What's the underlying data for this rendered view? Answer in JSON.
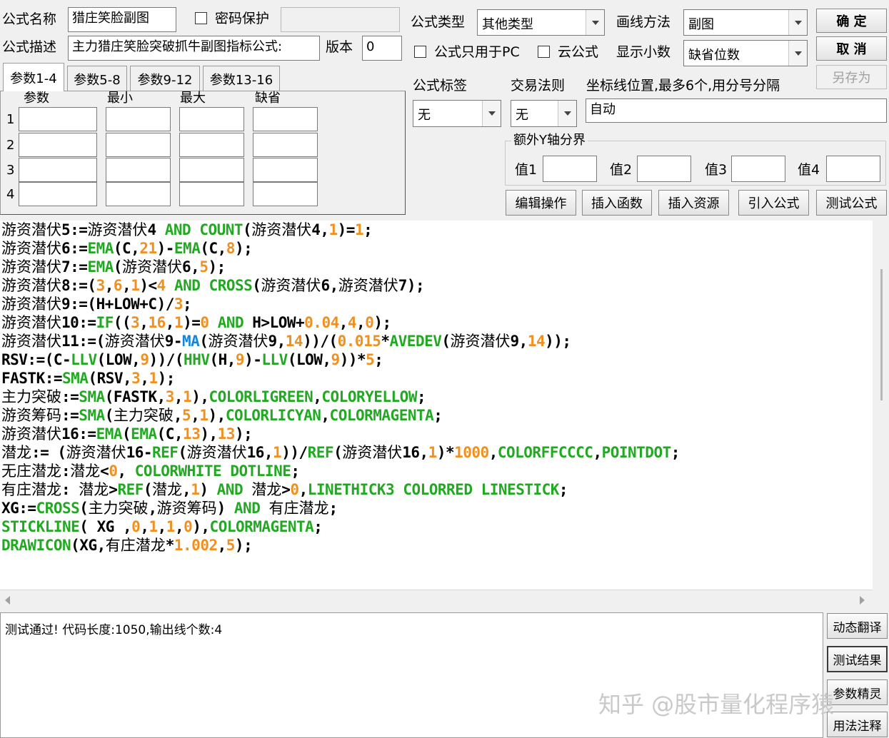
{
  "form": {
    "name_label": "公式名称",
    "name_value": "猎庄笑脸副图",
    "password_label": "密码保护",
    "desc_label": "公式描述",
    "desc_value": "主力猎庄笑脸突破抓牛副图指标公式:",
    "version_label": "版本",
    "version_value": "0",
    "type_label": "公式类型",
    "type_value": "其他类型",
    "draw_method_label": "画线方法",
    "draw_method_value": "副图",
    "pc_only_label": "公式只用于PC",
    "cloud_label": "云公式",
    "decimal_label": "显示小数",
    "decimal_value": "缺省位数",
    "tag_label": "公式标签",
    "tag_value": "无",
    "trade_rule_label": "交易法则",
    "trade_rule_value": "无",
    "axis_label": "坐标线位置,最多6个,用分号分隔",
    "axis_value": "自动",
    "extra_y_label": "额外Y轴分界",
    "val1_label": "值1",
    "val2_label": "值2",
    "val3_label": "值3",
    "val4_label": "值4"
  },
  "buttons": {
    "ok": "确 定",
    "cancel": "取 消",
    "save_as": "另存为",
    "edit": "编辑操作",
    "insert_func": "插入函数",
    "insert_res": "插入资源",
    "import": "引入公式",
    "test": "测试公式",
    "translate": "动态翻译",
    "test_result": "测试结果",
    "param_wizard": "参数精灵",
    "usage_note": "用法注释"
  },
  "tabs": [
    "参数1-4",
    "参数5-8",
    "参数9-12",
    "参数13-16"
  ],
  "param_headers": [
    "参数",
    "最小",
    "最大",
    "缺省"
  ],
  "param_rows": [
    "1",
    "2",
    "3",
    "4"
  ],
  "code_lines": [
    "游资潜伏5:=游资潜伏4 AND COUNT(游资潜伏4,1)=1;",
    "游资潜伏6:=EMA(C,21)-EMA(C,8);",
    "游资潜伏7:=EMA(游资潜伏6,5);",
    "游资潜伏8:=(3,6,1)<4 AND CROSS(游资潜伏6,游资潜伏7);",
    "游资潜伏9:=(H+LOW+C)/3;",
    "游资潜伏10:=IF((3,16,1)=0 AND H>LOW+0.04,4,0);",
    "游资潜伏11:=(游资潜伏9-MA(游资潜伏9,14))/(0.015*AVEDEV(游资潜伏9,14));",
    "RSV:=(C-LLV(LOW,9))/(HHV(H,9)-LLV(LOW,9))*5;",
    "FASTK:=SMA(RSV,3,1);",
    "主力突破:=SMA(FASTK,3,1),COLORLIGREEN,COLORYELLOW;",
    "游资筹码:=SMA(主力突破,5,1),COLORLICYAN,COLORMAGENTA;",
    "游资潜伏16:=EMA(EMA(C,13),13);",
    "潜龙:= (游资潜伏16-REF(游资潜伏16,1))/REF(游资潜伏16,1)*1000,COLORFFCCCC,POINTDOT;",
    "无庄潜龙:潜龙<0, COLORWHITE DOTLINE;",
    "有庄潜龙: 潜龙>REF(潜龙,1) AND 潜龙>0,LINETHICK3 COLORRED LINESTICK;",
    "XG:=CROSS(主力突破,游资筹码) AND 有庄潜龙;",
    "STICKLINE( XG ,0,1,1,0),COLORMAGENTA;",
    "DRAWICON(XG,有庄潜龙*1.002,5);"
  ],
  "result_text": "测试通过! 代码长度:1050,输出线个数:4",
  "watermark": "知乎 @股市量化程序猿",
  "colors": {
    "function": "#23a823",
    "number": "#f09020",
    "ma": "#1585d6",
    "background": "#f0f0f0"
  }
}
